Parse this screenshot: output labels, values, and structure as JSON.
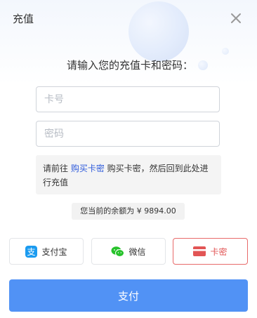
{
  "dialog": {
    "title": "充值",
    "prompt": "请输入您的充值卡和密码："
  },
  "form": {
    "card_placeholder": "卡号",
    "password_placeholder": "密码"
  },
  "notice": {
    "before_link": "请前往 ",
    "link_text": "购买卡密",
    "after_link": " 购买卡密，然后回到此处进行充值"
  },
  "balance": {
    "text": "您当前的余额为 ¥ 9894.00"
  },
  "payment_methods": [
    {
      "label": "支付宝",
      "icon": "alipay-icon",
      "color": "#1b9bf0",
      "selected": false
    },
    {
      "label": "微信",
      "icon": "wechat-icon",
      "color": "#27c22b",
      "selected": false
    },
    {
      "label": "卡密",
      "icon": "card-icon",
      "color": "#e25555",
      "selected": true
    }
  ],
  "submit": {
    "label": "支付"
  },
  "colors": {
    "primary": "#5192f5",
    "link": "#2f5bdb",
    "selected_border": "#e86a6a"
  }
}
